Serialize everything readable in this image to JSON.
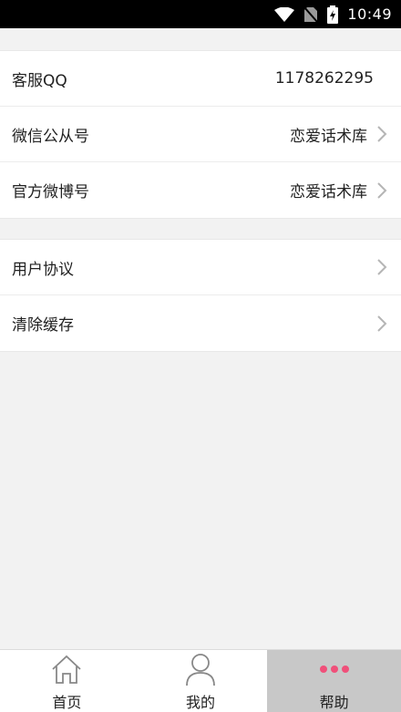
{
  "status_bar": {
    "time": "10:49",
    "icons": [
      "wifi-icon",
      "no-sim-icon",
      "battery-charging-icon"
    ]
  },
  "settings": {
    "group1": [
      {
        "label": "客服QQ",
        "value": "1178262295",
        "arrow": false
      },
      {
        "label": "微信公从号",
        "value": "恋爱话术库",
        "arrow": true
      },
      {
        "label": "官方微博号",
        "value": "恋爱话术库",
        "arrow": true
      }
    ],
    "group2": [
      {
        "label": "用户协议",
        "arrow": true
      },
      {
        "label": "清除缓存",
        "arrow": true
      }
    ]
  },
  "tabs": [
    {
      "label": "首页",
      "icon": "home-icon"
    },
    {
      "label": "我的",
      "icon": "user-icon"
    },
    {
      "label": "帮助",
      "icon": "more-dots-icon",
      "active": true
    }
  ],
  "colors": {
    "accent_dots": "#f0507a",
    "active_tab_bg": "#c8c8c8"
  }
}
